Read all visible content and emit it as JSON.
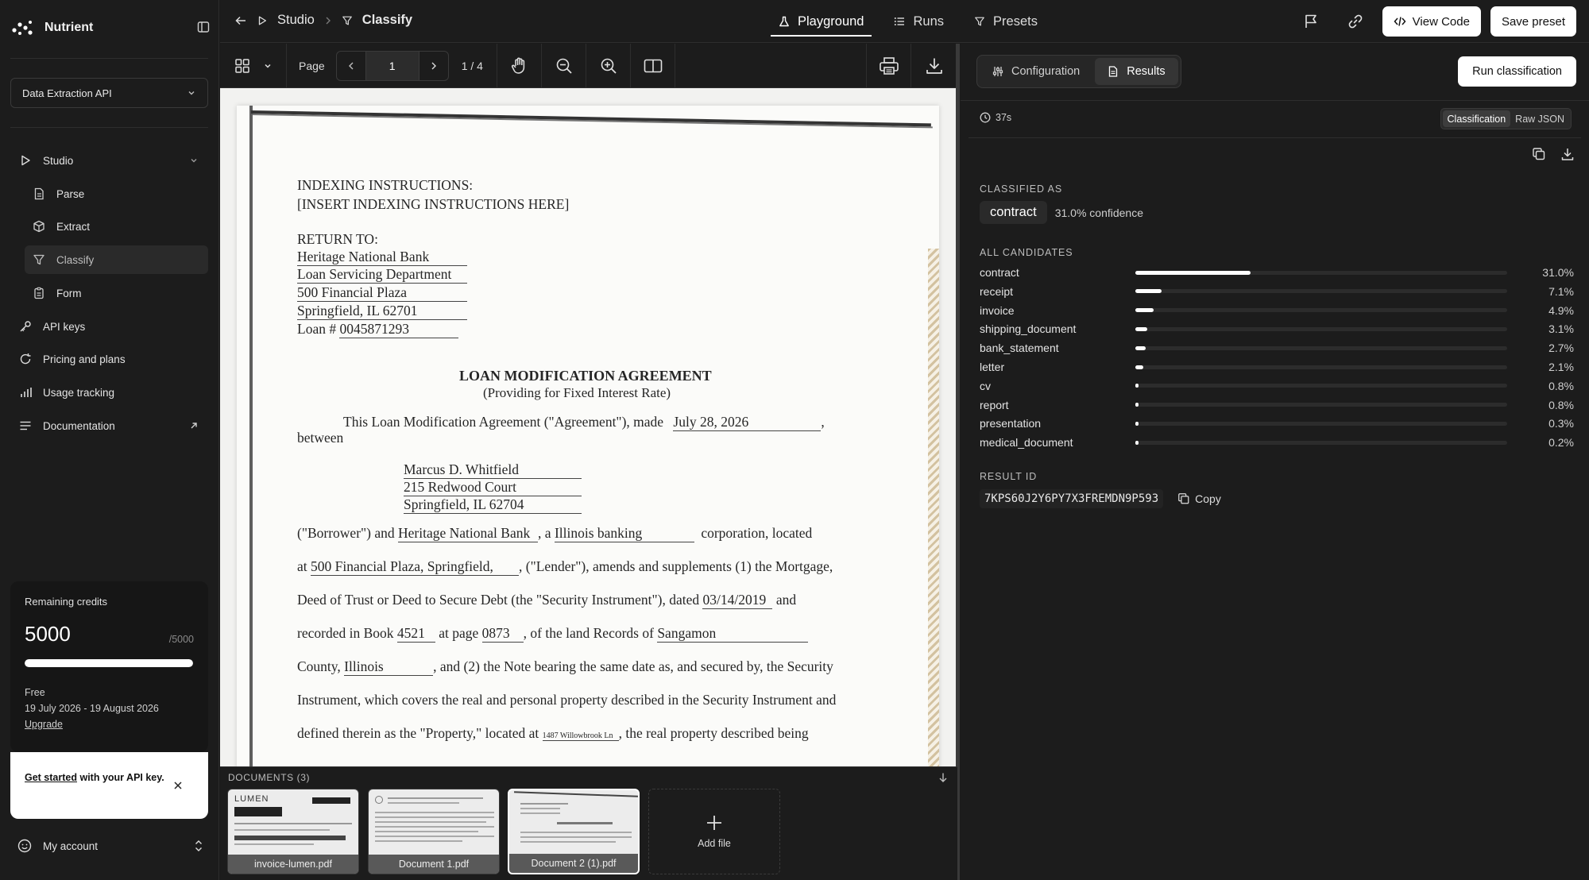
{
  "brand": {
    "name": "Nutrient"
  },
  "api_selector": {
    "value": "Data Extraction API"
  },
  "nav": {
    "studio": "Studio",
    "parse": "Parse",
    "extract": "Extract",
    "classify": "Classify",
    "form": "Form",
    "api_keys": "API keys",
    "pricing": "Pricing and plans",
    "usage": "Usage tracking",
    "documentation": "Documentation"
  },
  "credits": {
    "label": "Remaining credits",
    "remaining": "5000",
    "max": "/5000",
    "fraction": 1.0,
    "plan": "Free",
    "period": "19 July 2026 - 19 August 2026",
    "upgrade": "Upgrade"
  },
  "get_started": {
    "link": "Get started",
    "rest": " with your API key."
  },
  "account": {
    "label": "My account"
  },
  "breadcrumb": {
    "root": "Studio",
    "current": "Classify"
  },
  "tabs": {
    "playground": "Playground",
    "runs": "Runs",
    "presets": "Presets"
  },
  "top_actions": {
    "view_code": "View Code",
    "save_preset": "Save preset"
  },
  "viewer": {
    "page_label": "Page",
    "page_value": "1",
    "page_count": "1 / 4"
  },
  "document": {
    "indexing_title": "INDEXING INSTRUCTIONS:",
    "indexing_sub": "[INSERT INDEXING INSTRUCTIONS HERE]",
    "return_to": "RETURN TO:",
    "addr1": "Heritage National Bank",
    "addr2": "Loan Servicing Department",
    "addr3": "500 Financial Plaza",
    "addr4": "Springfield, IL 62701",
    "loan_prefix": "Loan #",
    "loan_no": "0045871293",
    "title": "LOAN MODIFICATION AGREEMENT",
    "subtitle": "(Providing for Fixed Interest Rate)",
    "p1a": "This  Loan  Modification  Agreement  (\"Agreement\"),  made",
    "p1_date": "July 28, 2026",
    "p1b": "between",
    "borrower_name": "Marcus D. Whitfield",
    "borrower_street": "215 Redwood Court",
    "borrower_city": "Springfield, IL 62704",
    "l1a": "(\"Borrower\")  and",
    "l1_lender": "Heritage National Bank",
    "l1b": ",  a",
    "l1_state": "Illinois banking",
    "l1c": "corporation,  located",
    "l2a": "at",
    "l2_addr": "500 Financial Plaza, Springfield,",
    "l2b": ",  (\"Lender\"),  amends  and  supplements  (1)  the  Mortgage,",
    "l3a": "Deed  of  Trust  or  Deed  to  Secure  Debt  (the  \"Security  Instrument\"),  dated",
    "l3_date": "03/14/2019",
    "l3b": "and",
    "l4a": "recorded  in  Book",
    "l4_book": "4521",
    "l4b": "at  page",
    "l4_page": "0873",
    "l4c": ",  of  the  land  Records  of",
    "l4_county": "Sangamon",
    "l5a": "County,",
    "l5_state": "Illinois",
    "l5b": ",  and  (2)  the  Note  bearing  the  same  date  as,  and  secured  by,  the  Security",
    "l6": "Instrument,  which  covers  the  real  and  personal  property  described  in  the  Security  Instrument  and",
    "l7a": "defined  therein  as  the  \"Property,\"  located  at",
    "l7_addr": "1487 Willowbrook Ln",
    "l7b": ",  the  real  property  described  being"
  },
  "documents": {
    "title": "DOCUMENTS (3)",
    "items": [
      {
        "name": "invoice-lumen.pdf",
        "brand": "LUMEN"
      },
      {
        "name": "Document 1.pdf"
      },
      {
        "name": "Document 2 (1).pdf"
      }
    ],
    "add_label": "Add file"
  },
  "panel": {
    "seg_configuration": "Configuration",
    "seg_results": "Results",
    "run_button": "Run classification",
    "time": "37s",
    "toggle_classification": "Classification",
    "toggle_raw": "Raw JSON",
    "classified_as_label": "CLASSIFIED AS",
    "classified_value": "contract",
    "confidence": "31.0% confidence",
    "candidates_label": "ALL CANDIDATES",
    "candidates": [
      {
        "name": "contract",
        "value": 31.0,
        "label": "31.0%"
      },
      {
        "name": "receipt",
        "value": 7.1,
        "label": "7.1%"
      },
      {
        "name": "invoice",
        "value": 4.9,
        "label": "4.9%"
      },
      {
        "name": "shipping_document",
        "value": 3.1,
        "label": "3.1%"
      },
      {
        "name": "bank_statement",
        "value": 2.7,
        "label": "2.7%"
      },
      {
        "name": "letter",
        "value": 2.1,
        "label": "2.1%"
      },
      {
        "name": "cv",
        "value": 0.8,
        "label": "0.8%"
      },
      {
        "name": "report",
        "value": 0.8,
        "label": "0.8%"
      },
      {
        "name": "presentation",
        "value": 0.3,
        "label": "0.3%"
      },
      {
        "name": "medical_document",
        "value": 0.2,
        "label": "0.2%"
      }
    ],
    "result_id_label": "RESULT ID",
    "result_id": "7KPS60J2Y6PY7X3FREMDN9P593",
    "copy_label": "Copy"
  },
  "colors": {
    "bg": "#1a1a1a",
    "panel": "#1c1c1c",
    "border": "#2e2e2e",
    "accent": "#ffffff"
  }
}
